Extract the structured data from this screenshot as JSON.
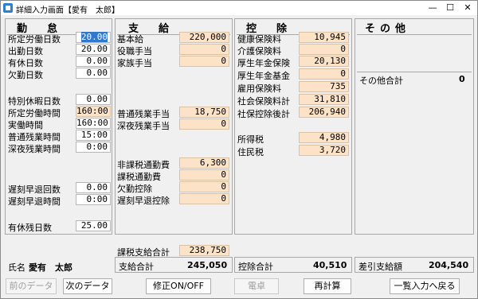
{
  "window": {
    "title": "詳細入力画面【愛有　太郎】",
    "close_icon": "close-icon",
    "max_icon": "maximize-icon",
    "min_icon": "minimize-icon"
  },
  "kintai": {
    "heading": "勤　怠",
    "rows": [
      {
        "label": "所定労働日数",
        "value": "20.00"
      },
      {
        "label": "出勤日数",
        "value": "20.00"
      },
      {
        "label": "有休日数",
        "value": "0.00"
      },
      {
        "label": "欠勤日数",
        "value": "0.00"
      },
      {
        "label": "特別休暇日数",
        "value": "0.00"
      },
      {
        "label": "所定労働時間",
        "value": "160:00"
      },
      {
        "label": "実働時間",
        "value": "160:00"
      },
      {
        "label": "普通残業時間",
        "value": "15:00"
      },
      {
        "label": "深夜残業時間",
        "value": "0:00"
      },
      {
        "label": "遅刻早退回数",
        "value": "0.00"
      },
      {
        "label": "遅刻早退時間",
        "value": "0:00"
      },
      {
        "label": "有休残日数",
        "value": "25.00"
      }
    ]
  },
  "shikyu": {
    "heading": "支　給",
    "rows": [
      {
        "label": "基本給",
        "value": "220,000"
      },
      {
        "label": "役職手当",
        "value": "0"
      },
      {
        "label": "家族手当",
        "value": "0"
      },
      {
        "label": "普通残業手当",
        "value": "18,750"
      },
      {
        "label": "深夜残業手当",
        "value": "0"
      },
      {
        "label": "非課税通勤費",
        "value": "6,300"
      },
      {
        "label": "課税通勤費",
        "value": "0"
      },
      {
        "label": "欠勤控除",
        "value": "0"
      },
      {
        "label": "遅刻早退控除",
        "value": "0"
      },
      {
        "label": "課税支給合計",
        "value": "238,750"
      }
    ]
  },
  "kojo": {
    "heading": "控　除",
    "rows": [
      {
        "label": "健康保険料",
        "value": "10,945"
      },
      {
        "label": "介護保険料",
        "value": "0"
      },
      {
        "label": "厚生年金保険",
        "value": "20,130"
      },
      {
        "label": "厚生年金基金",
        "value": "0"
      },
      {
        "label": "雇用保険料",
        "value": "735"
      },
      {
        "label": "社会保険料計",
        "value": "31,810"
      },
      {
        "label": "社保控除後計",
        "value": "206,940"
      },
      {
        "label": "所得税",
        "value": "4,980"
      },
      {
        "label": "住民税",
        "value": "3,720"
      }
    ]
  },
  "sonota": {
    "heading": "その他",
    "total_label": "その他合計",
    "total_value": "0"
  },
  "footer": {
    "name_label": "氏名",
    "name_value": "愛有　太郎",
    "shikyu_label": "支給合計",
    "shikyu_value": "245,050",
    "kojo_label": "控除合計",
    "kojo_value": "40,510",
    "sashihiki_label": "差引支給額",
    "sashihiki_value": "204,540"
  },
  "buttons": {
    "prev": "前のデータ",
    "next": "次のデータ",
    "toggle": "修正ON/OFF",
    "calc": "電卓",
    "recalc": "再計算",
    "back": "一覧入力へ戻る"
  }
}
